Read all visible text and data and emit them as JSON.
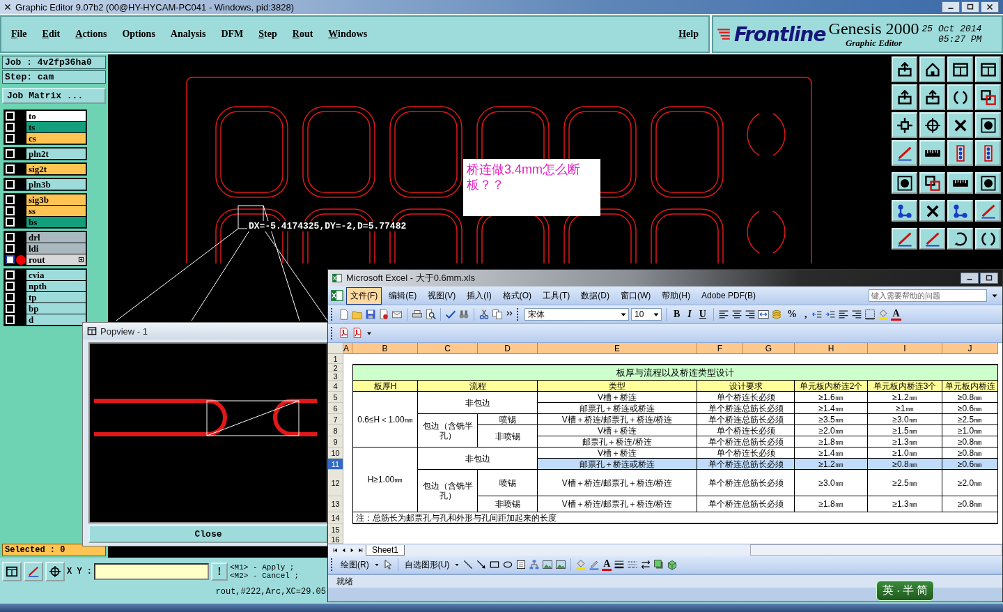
{
  "genesis": {
    "title": "Graphic Editor 9.07b2 (00@HY-HYCAM-PC041 - Windows, pid:3828)",
    "menu": [
      {
        "label": "File",
        "underlined": true
      },
      {
        "label": "Edit",
        "underlined": true
      },
      {
        "label": "Actions",
        "underlined": true
      },
      {
        "label": "Options",
        "underlined": false
      },
      {
        "label": "Analysis",
        "underlined": false
      },
      {
        "label": "DFM",
        "underlined": false
      },
      {
        "label": "Step",
        "underlined": true
      },
      {
        "label": "Rout",
        "underlined": true
      },
      {
        "label": "Windows",
        "underlined": true
      }
    ],
    "help": "Help",
    "brand": {
      "logo": "Frontline",
      "product": "Genesis 2000",
      "subtitle": "Graphic Editor",
      "date": "25 Oct 2014",
      "time": "05:27 PM"
    },
    "job": "Job : 4v2fp36ha0",
    "step": "Step: cam",
    "job_matrix": "Job Matrix ...",
    "layer_groups": [
      {
        "layers": [
          {
            "name": "to",
            "color": "#ffffff",
            "checked": false,
            "work": false
          },
          {
            "name": "ts",
            "color": "#139e7c",
            "checked": false,
            "work": false
          },
          {
            "name": "cs",
            "color": "#ffc451",
            "checked": false,
            "work": false
          }
        ]
      },
      {
        "layers": [
          {
            "name": "pln2t",
            "color": "#9edcdc",
            "checked": false,
            "work": false
          }
        ]
      },
      {
        "layers": [
          {
            "name": "sig2t",
            "color": "#ffc451",
            "checked": false,
            "work": false
          }
        ]
      },
      {
        "layers": [
          {
            "name": "pln3b",
            "color": "#9edcdc",
            "checked": false,
            "work": false
          }
        ]
      },
      {
        "layers": [
          {
            "name": "sig3b",
            "color": "#ffc451",
            "checked": false,
            "work": false
          },
          {
            "name": "ss",
            "color": "#ffc451",
            "checked": false,
            "work": false
          },
          {
            "name": "bs",
            "color": "#139e7c",
            "checked": false,
            "work": false
          }
        ]
      },
      {
        "layers": [
          {
            "name": "drl",
            "color": "#a9b9bf",
            "checked": false,
            "work": false
          },
          {
            "name": "ldi",
            "color": "#a9b9bf",
            "checked": false,
            "work": false
          },
          {
            "name": "rout",
            "color": "#d8d8d8",
            "checked": false,
            "work": true
          }
        ]
      },
      {
        "layers": [
          {
            "name": "cvia",
            "color": "#9edcdc",
            "checked": false,
            "work": false
          },
          {
            "name": "npth",
            "color": "#9edcdc",
            "checked": false,
            "work": false
          },
          {
            "name": "tp",
            "color": "#9edcdc",
            "checked": false,
            "work": false
          },
          {
            "name": "bp",
            "color": "#9edcdc",
            "checked": false,
            "work": false
          },
          {
            "name": "d",
            "color": "#9edcdc",
            "checked": false,
            "work": false
          }
        ]
      }
    ],
    "canvas": {
      "note": "桥连做3.4mm怎么断板？？",
      "measure": "DX=-5.4174325,DY=-2,D=5.77482"
    },
    "popview": {
      "title": "Popview - 1",
      "close": "Close"
    },
    "selected": "Selected : 0",
    "coords_label": "X Y :",
    "confirm_button": "!",
    "mouse_hints": [
      "<M1> - Apply ;",
      "<M2> - Cancel ;"
    ],
    "status": "rout,#222,Arc,XC=29.05"
  },
  "excel": {
    "title": "Microsoft Excel - 大于0.6mm.xls",
    "menu": [
      {
        "label": "文件(F)",
        "selected": true
      },
      {
        "label": "编辑(E)",
        "selected": false
      },
      {
        "label": "视图(V)",
        "selected": false
      },
      {
        "label": "插入(I)",
        "selected": false
      },
      {
        "label": "格式(O)",
        "selected": false
      },
      {
        "label": "工具(T)",
        "selected": false
      },
      {
        "label": "数据(D)",
        "selected": false
      },
      {
        "label": "窗口(W)",
        "selected": false
      },
      {
        "label": "帮助(H)",
        "selected": false
      },
      {
        "label": "Adobe PDF(B)",
        "selected": false
      }
    ],
    "help_placeholder": "键入需要帮助的问题",
    "font": "宋体",
    "font_size": "10",
    "format_glyphs": [
      "B",
      "I",
      "U"
    ],
    "number_glyphs": [
      "%",
      ","
    ],
    "font_color_glyph": "A",
    "columns": [
      "A",
      "B",
      "C",
      "D",
      "E",
      "F",
      "G",
      "H",
      "I",
      "J"
    ],
    "rows": [
      {
        "header": "1",
        "selected": false
      },
      {
        "header": "2",
        "selected": false,
        "cells": [
          {
            "text": "板厚与流程以及桥连类型设计",
            "kind": "title"
          }
        ]
      },
      {
        "header": "3",
        "selected": false
      },
      {
        "header": "4",
        "selected": false,
        "cells": [
          {
            "text": "板厚H",
            "kind": "header"
          },
          {
            "text": "流程",
            "kind": "header"
          },
          {
            "text": "类型",
            "kind": "header"
          },
          {
            "text": "设计要求",
            "kind": "header"
          },
          {
            "text": "单元板内桥连2个",
            "kind": "header"
          },
          {
            "text": "单元板内桥连3个",
            "kind": "header"
          },
          {
            "text": "单元板内桥连",
            "kind": "header"
          }
        ]
      },
      {
        "header": "5",
        "selected": false,
        "cells": [
          {
            "text": "0.6≤H＜1.00㎜",
            "kind": "data"
          },
          {
            "text": "非包边",
            "kind": "data"
          },
          {
            "text": "V槽＋桥连",
            "kind": "data"
          },
          {
            "text": "单个桥连长必须",
            "kind": "data"
          },
          {
            "text": "≥1.6㎜",
            "kind": "data"
          },
          {
            "text": "≥1.2㎜",
            "kind": "data"
          },
          {
            "text": "≥0.8㎜",
            "kind": "data"
          }
        ]
      },
      {
        "header": "6",
        "selected": false,
        "cells": [
          {
            "text": "邮票孔＋桥连或桥连",
            "kind": "data"
          },
          {
            "text": "单个桥连总筋长必须",
            "kind": "data"
          },
          {
            "text": "≥1.4㎜",
            "kind": "data"
          },
          {
            "text": "≥1㎜",
            "kind": "data"
          },
          {
            "text": "≥0.6㎜",
            "kind": "data"
          }
        ]
      },
      {
        "header": "7",
        "selected": false,
        "cells": [
          {
            "text": "包边（含铣半孔）",
            "kind": "data"
          },
          {
            "text": "喷锡",
            "kind": "data"
          },
          {
            "text": "V槽＋桥连/邮票孔＋桥连/桥连",
            "kind": "data"
          },
          {
            "text": "单个桥连总筋长必须",
            "kind": "data"
          },
          {
            "text": "≥3.5㎜",
            "kind": "data"
          },
          {
            "text": "≥3.0㎜",
            "kind": "data"
          },
          {
            "text": "≥2.5㎜",
            "kind": "data"
          }
        ]
      },
      {
        "header": "8",
        "selected": false,
        "cells": [
          {
            "text": "非喷锡",
            "kind": "data"
          },
          {
            "text": "V槽＋桥连",
            "kind": "data"
          },
          {
            "text": "单个桥连长必须",
            "kind": "data"
          },
          {
            "text": "≥2.0㎜",
            "kind": "data"
          },
          {
            "text": "≥1.5㎜",
            "kind": "data"
          },
          {
            "text": "≥1.0㎜",
            "kind": "data"
          }
        ]
      },
      {
        "header": "9",
        "selected": false,
        "cells": [
          {
            "text": "邮票孔＋桥连/桥连",
            "kind": "data"
          },
          {
            "text": "单个桥连总筋长必须",
            "kind": "data"
          },
          {
            "text": "≥1.8㎜",
            "kind": "data"
          },
          {
            "text": "≥1.3㎜",
            "kind": "data"
          },
          {
            "text": "≥0.8㎜",
            "kind": "data"
          }
        ]
      },
      {
        "header": "10",
        "selected": false,
        "cells": [
          {
            "text": "H≥1.00㎜",
            "kind": "data"
          },
          {
            "text": "非包边",
            "kind": "data"
          },
          {
            "text": "V槽＋桥连",
            "kind": "data"
          },
          {
            "text": "单个桥连长必须",
            "kind": "data"
          },
          {
            "text": "≥1.4㎜",
            "kind": "data"
          },
          {
            "text": "≥1.0㎜",
            "kind": "data"
          },
          {
            "text": "≥0.8㎜",
            "kind": "data"
          }
        ]
      },
      {
        "header": "11",
        "selected": true,
        "cells": [
          {
            "text": "邮票孔＋桥连或桥连",
            "kind": "data"
          },
          {
            "text": "单个桥连总筋长必须",
            "kind": "data"
          },
          {
            "text": "≥1.2㎜",
            "kind": "data"
          },
          {
            "text": "≥0.8㎜",
            "kind": "data"
          },
          {
            "text": "≥0.6㎜",
            "kind": "data"
          }
        ]
      },
      {
        "header": "12",
        "selected": false,
        "cells": [
          {
            "text": "包边（含铣半孔）",
            "kind": "data"
          },
          {
            "text": "喷锡",
            "kind": "data"
          },
          {
            "text": "V槽＋桥连/邮票孔＋桥连/桥连",
            "kind": "data"
          },
          {
            "text": "单个桥连总筋长必须",
            "kind": "data"
          },
          {
            "text": "≥3.0㎜",
            "kind": "data"
          },
          {
            "text": "≥2.5㎜",
            "kind": "data"
          },
          {
            "text": "≥2.0㎜",
            "kind": "data"
          }
        ]
      },
      {
        "header": "13",
        "selected": false,
        "cells": [
          {
            "text": "非喷锡",
            "kind": "data"
          },
          {
            "text": "V槽＋桥连/邮票孔＋桥连/桥连",
            "kind": "data"
          },
          {
            "text": "单个桥连总筋长必须",
            "kind": "data"
          },
          {
            "text": "≥1.8㎜",
            "kind": "data"
          },
          {
            "text": "≥1.3㎜",
            "kind": "data"
          },
          {
            "text": "≥0.8㎜",
            "kind": "data"
          }
        ]
      },
      {
        "header": "14",
        "selected": false,
        "cells": [
          {
            "text": "注：总筋长为邮票孔与孔和外形与孔间距加起来的长度",
            "kind": "note"
          }
        ]
      },
      {
        "header": "15",
        "selected": false
      },
      {
        "header": "16",
        "selected": false
      }
    ],
    "sheet_tab": "Sheet1",
    "draw_menu": "绘图(R)",
    "autoshapes": "自选图形(U)",
    "draw_font_color_glyph": "A",
    "status": "就绪"
  },
  "ime": [
    "英",
    "·",
    "半",
    "简"
  ]
}
